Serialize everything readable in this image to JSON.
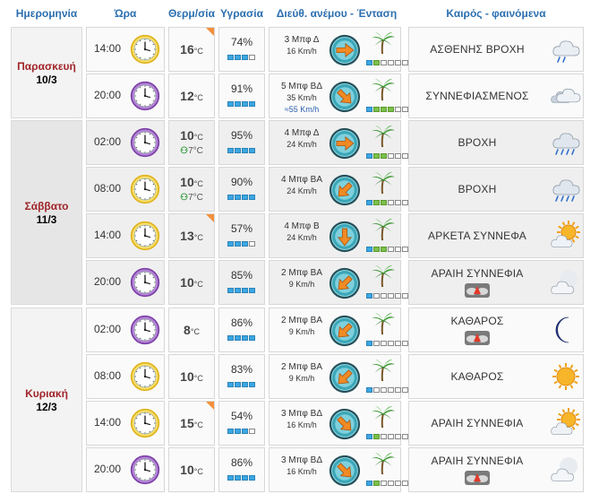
{
  "headers": {
    "date": "Ημερομηνία",
    "time": "Ώρα",
    "temp": "Θερμ/σία",
    "humidity": "Υγρασία",
    "wind": "Διεύθ. ανέμου - Ένταση",
    "weather": "Καιρός - φαινόμενα"
  },
  "days": [
    {
      "name": "Παρασκευή",
      "date": "10/3"
    },
    {
      "name": "Σάββατο",
      "date": "11/3"
    },
    {
      "name": "Κυριακή",
      "date": "12/3"
    }
  ],
  "unit_c": "°C",
  "rows": [
    {
      "time": "14:00",
      "temp": "16",
      "feels": "",
      "hum": "74%",
      "hum_level": 3,
      "wind": "3 Μπφ Δ",
      "kmh": "16 Km/h",
      "gust": "",
      "wind_level": 1,
      "wx": "ΑΣΘΕΝΗΣ ΒΡΟΧΗ",
      "icon": "rain-light-icon",
      "clock": "day",
      "hot": true
    },
    {
      "time": "20:00",
      "temp": "12",
      "feels": "",
      "hum": "91%",
      "hum_level": 4,
      "wind": "5 Μπφ ΒΔ",
      "kmh": "35 Km/h",
      "gust": "55 Km/h",
      "wind_level": 3,
      "wx": "ΣΥΝΝΕΦΙΑΣΜΕΝΟΣ",
      "icon": "cloudy-icon",
      "clock": "night",
      "hot": false
    },
    {
      "time": "02:00",
      "temp": "10",
      "feels": "7",
      "hum": "95%",
      "hum_level": 4,
      "wind": "4 Μπφ Δ",
      "kmh": "24 Km/h",
      "gust": "",
      "wind_level": 2,
      "wx": "ΒΡΟΧΗ",
      "icon": "rain-icon",
      "clock": "night",
      "hot": false
    },
    {
      "time": "08:00",
      "temp": "10",
      "feels": "7",
      "hum": "90%",
      "hum_level": 4,
      "wind": "4 Μπφ ΒΑ",
      "kmh": "24 Km/h",
      "gust": "",
      "wind_level": 2,
      "wx": "ΒΡΟΧΗ",
      "icon": "rain-icon",
      "clock": "day",
      "hot": false
    },
    {
      "time": "14:00",
      "temp": "13",
      "feels": "",
      "hum": "57%",
      "hum_level": 3,
      "wind": "4 Μπφ Β",
      "kmh": "24 Km/h",
      "gust": "",
      "wind_level": 2,
      "wx": "ΑΡΚΕΤΑ ΣΥΝΝΕΦΑ",
      "icon": "sun-cloud-icon",
      "clock": "day",
      "hot": true
    },
    {
      "time": "20:00",
      "temp": "10",
      "feels": "",
      "hum": "85%",
      "hum_level": 4,
      "wind": "2 Μπφ ΒΑ",
      "kmh": "9 Km/h",
      "gust": "",
      "wind_level": 0,
      "wx": "ΑΡΑΙΗ ΣΥΝΝΕΦΙΑ",
      "icon": "moon-cloud-icon",
      "clock": "night",
      "hot": false,
      "fog": true
    },
    {
      "time": "02:00",
      "temp": "8",
      "feels": "",
      "hum": "86%",
      "hum_level": 4,
      "wind": "2 Μπφ ΒΑ",
      "kmh": "9 Km/h",
      "gust": "",
      "wind_level": 0,
      "wx": "ΚΑΘΑΡΟΣ",
      "icon": "moon-icon",
      "clock": "night",
      "hot": false,
      "fog": true
    },
    {
      "time": "08:00",
      "temp": "10",
      "feels": "",
      "hum": "83%",
      "hum_level": 4,
      "wind": "2 Μπφ ΒΑ",
      "kmh": "9 Km/h",
      "gust": "",
      "wind_level": 0,
      "wx": "ΚΑΘΑΡΟΣ",
      "icon": "sun-icon",
      "clock": "day",
      "hot": false
    },
    {
      "time": "14:00",
      "temp": "15",
      "feels": "",
      "hum": "54%",
      "hum_level": 3,
      "wind": "3 Μπφ ΒΔ",
      "kmh": "16 Km/h",
      "gust": "",
      "wind_level": 1,
      "wx": "ΑΡΑΙΗ ΣΥΝΝΕΦΙΑ",
      "icon": "sun-cloud-icon",
      "clock": "day",
      "hot": true
    },
    {
      "time": "20:00",
      "temp": "10",
      "feels": "",
      "hum": "86%",
      "hum_level": 4,
      "wind": "3 Μπφ ΒΔ",
      "kmh": "16 Km/h",
      "gust": "",
      "wind_level": 1,
      "wx": "ΑΡΑΙΗ ΣΥΝΝΕΦΙΑ",
      "icon": "moon-cloud-icon",
      "clock": "night",
      "hot": false,
      "fog": true
    }
  ],
  "colors": {
    "header": "#2b6fb0",
    "day_name": "#a0252a",
    "hot_corner": "#f4903b",
    "humidity_on": "#3aa7e4",
    "wind_on": "#7cc04a"
  }
}
